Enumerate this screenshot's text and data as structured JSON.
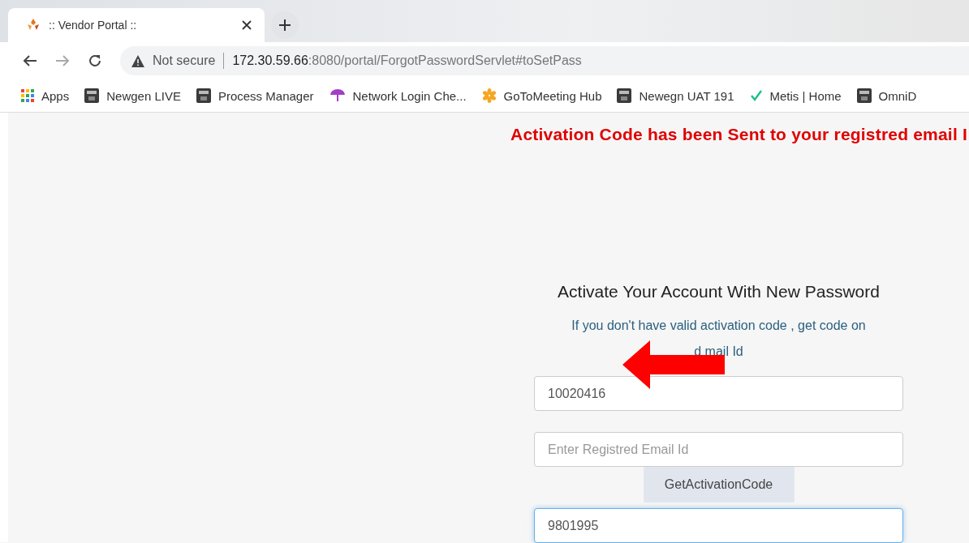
{
  "browser": {
    "tab": {
      "title": ":: Vendor Portal ::"
    },
    "address": {
      "security": "Not secure",
      "host": "172.30.59.66",
      "rest": ":8080/portal/ForgotPasswordServlet#toSetPass"
    },
    "bookmarks": [
      {
        "label": "Apps",
        "kind": "apps"
      },
      {
        "label": "Newgen LIVE",
        "kind": "eap"
      },
      {
        "label": "Process Manager",
        "kind": "eap"
      },
      {
        "label": "Network Login Che...",
        "kind": "umbrella"
      },
      {
        "label": "GoToMeeting Hub",
        "kind": "flower"
      },
      {
        "label": "Newegn UAT 191",
        "kind": "eap"
      },
      {
        "label": "Metis | Home",
        "kind": "check"
      },
      {
        "label": "OmniD",
        "kind": "eap"
      }
    ]
  },
  "page": {
    "message": "Activation Code has been Sent to your registred email I",
    "heading": "Activate Your Account With New Password",
    "hint_lines": [
      "If you don't have valid activation code , get code on",
      "d mail Id"
    ],
    "form": [
      {
        "kind": "field",
        "value": "10020416",
        "focused": false
      },
      {
        "kind": "field",
        "placeholder": "Enter Registred Email Id",
        "focused": false
      },
      {
        "kind": "button",
        "label": "GetActivationCode"
      },
      {
        "kind": "field",
        "value": "9801995",
        "focused": true
      }
    ]
  }
}
